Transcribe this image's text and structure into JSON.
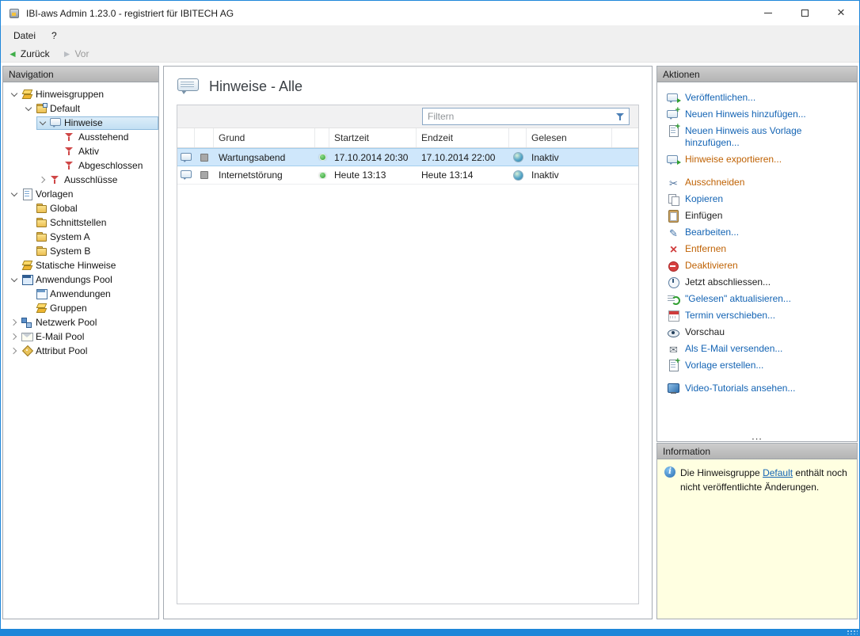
{
  "window": {
    "title": "IBI-aws Admin 1.23.0 - registriert für IBITECH AG"
  },
  "menu": {
    "items": [
      {
        "label": "Datei"
      },
      {
        "label": "?"
      }
    ]
  },
  "toolbar": {
    "back": "Zurück",
    "forward": "Vor"
  },
  "nav": {
    "header": "Navigation",
    "items": [
      {
        "label": "Hinweisgruppen",
        "level": 0,
        "state": "expanded",
        "icon": "group-stack-icon"
      },
      {
        "label": "Default",
        "level": 1,
        "state": "expanded",
        "icon": "notice-group-icon"
      },
      {
        "label": "Hinweise",
        "level": 2,
        "state": "expanded",
        "icon": "notes-icon",
        "selected": true
      },
      {
        "label": "Ausstehend",
        "level": 3,
        "state": "leaf",
        "icon": "filter-pending-icon"
      },
      {
        "label": "Aktiv",
        "level": 3,
        "state": "leaf",
        "icon": "filter-active-icon"
      },
      {
        "label": "Abgeschlossen",
        "level": 3,
        "state": "leaf",
        "icon": "filter-completed-icon"
      },
      {
        "label": "Ausschlüsse",
        "level": 2,
        "state": "collapsed",
        "icon": "exclusions-filter-icon"
      },
      {
        "label": "Vorlagen",
        "level": 0,
        "state": "expanded",
        "icon": "templates-icon"
      },
      {
        "label": "Global",
        "level": 1,
        "state": "leaf",
        "icon": "folder-icon"
      },
      {
        "label": "Schnittstellen",
        "level": 1,
        "state": "leaf",
        "icon": "folder-icon"
      },
      {
        "label": "System A",
        "level": 1,
        "state": "leaf",
        "icon": "folder-icon"
      },
      {
        "label": "System B",
        "level": 1,
        "state": "leaf",
        "icon": "folder-icon"
      },
      {
        "label": "Statische Hinweise",
        "level": 0,
        "state": "leaf",
        "icon": "static-notes-icon"
      },
      {
        "label": "Anwendungs Pool",
        "level": 0,
        "state": "expanded",
        "icon": "application-pool-icon"
      },
      {
        "label": "Anwendungen",
        "level": 1,
        "state": "leaf",
        "icon": "applications-icon"
      },
      {
        "label": "Gruppen",
        "level": 1,
        "state": "leaf",
        "icon": "groups-icon"
      },
      {
        "label": "Netzwerk Pool",
        "level": 0,
        "state": "collapsed",
        "icon": "network-pool-icon"
      },
      {
        "label": "E-Mail Pool",
        "level": 0,
        "state": "collapsed",
        "icon": "email-pool-icon"
      },
      {
        "label": "Attribut Pool",
        "level": 0,
        "state": "collapsed",
        "icon": "attribute-pool-icon"
      }
    ]
  },
  "main": {
    "title": "Hinweise - Alle",
    "filter": {
      "placeholder": "Filtern",
      "icon": "filter-funnel-icon"
    },
    "table": {
      "columns": [
        {
          "label": "",
          "name": "note-type-icon"
        },
        {
          "label": "",
          "name": "published-flag"
        },
        {
          "label": "Grund"
        },
        {
          "label": "",
          "name": "status-dot"
        },
        {
          "label": "Startzeit"
        },
        {
          "label": "Endzeit"
        },
        {
          "label": "",
          "name": "gelesen-icon"
        },
        {
          "label": "Gelesen"
        }
      ],
      "rows": [
        {
          "grund": "Wartungsabend",
          "status": "active",
          "startzeit": "17.10.2014 20:30",
          "endzeit": "17.10.2014 22:00",
          "gelesen": "Inaktiv",
          "selected": true
        },
        {
          "grund": "Internetstörung",
          "status": "active",
          "startzeit": "Heute 13:13",
          "endzeit": "Heute 13:14",
          "gelesen": "Inaktiv",
          "selected": false
        }
      ]
    }
  },
  "actions": {
    "header": "Aktionen",
    "overflow": "...",
    "items": [
      {
        "label": "Veröffentlichen...",
        "icon": "publish-icon",
        "color": "#1464b4"
      },
      {
        "label": "Neuen Hinweis hinzufügen...",
        "icon": "add-note-icon",
        "color": "#1464b4"
      },
      {
        "label": "Neuen Hinweis aus Vorlage hinzufügen...",
        "icon": "add-note-from-template-icon",
        "color": "#1464b4"
      },
      {
        "label": "Hinweise exportieren...",
        "icon": "export-notes-icon",
        "color": "#bf6204"
      },
      {
        "label": "Ausschneiden",
        "icon": "cut-icon",
        "color": "#bf6204"
      },
      {
        "label": "Kopieren",
        "icon": "copy-icon",
        "color": "#1464b4"
      },
      {
        "label": "Einfügen",
        "icon": "paste-icon",
        "color": "#1e1e1e"
      },
      {
        "label": "Bearbeiten...",
        "icon": "edit-icon",
        "color": "#1464b4"
      },
      {
        "label": "Entfernen",
        "icon": "remove-icon",
        "color": "#bf6204"
      },
      {
        "label": "Deaktivieren",
        "icon": "deactivate-icon",
        "color": "#bf6204"
      },
      {
        "label": "Jetzt abschliessen...",
        "icon": "finish-now-icon",
        "color": "#1e1e1e"
      },
      {
        "label": "\"Gelesen\" aktualisieren...",
        "icon": "update-read-icon",
        "color": "#1464b4"
      },
      {
        "label": "Termin verschieben...",
        "icon": "reschedule-icon",
        "color": "#1464b4"
      },
      {
        "label": "Vorschau",
        "icon": "preview-icon",
        "color": "#1e1e1e"
      },
      {
        "label": "Als E-Mail versenden...",
        "icon": "send-email-icon",
        "color": "#1464b4"
      },
      {
        "label": "Vorlage erstellen...",
        "icon": "create-template-icon",
        "color": "#1464b4"
      },
      {
        "label": "Video-Tutorials ansehen...",
        "icon": "video-tutorials-icon",
        "color": "#1464b4"
      }
    ]
  },
  "info": {
    "header": "Information",
    "icon": "info-icon",
    "text_before": "Die Hinweisgruppe ",
    "link_text": "Default",
    "text_after": " enthält noch nicht veröffentlichte Änderungen."
  },
  "colors": {
    "window_frame": "#1e86d9",
    "link_blue": "#1464b4",
    "link_orange": "#bf6204",
    "selection_blue": "#cfe7fb",
    "info_background": "#ffffe1"
  }
}
